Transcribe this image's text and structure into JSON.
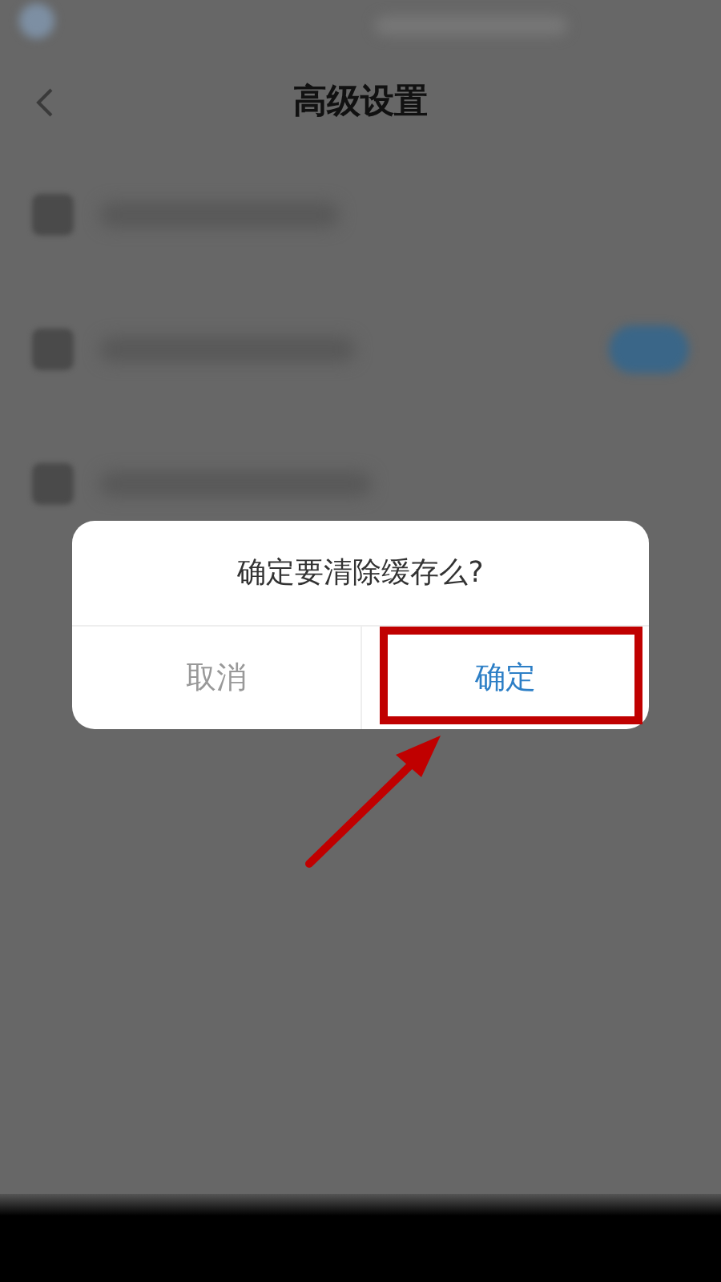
{
  "header": {
    "title": "高级设置"
  },
  "settings_rows": [
    {
      "kind": "plain"
    },
    {
      "kind": "toggle",
      "on": true
    },
    {
      "kind": "plain"
    }
  ],
  "dialog": {
    "message": "确定要清除缓存么?",
    "buttons": [
      {
        "label": "取消",
        "kind": "cancel",
        "highlighted": false
      },
      {
        "label": "确定",
        "kind": "confirm",
        "highlighted": true
      }
    ]
  }
}
